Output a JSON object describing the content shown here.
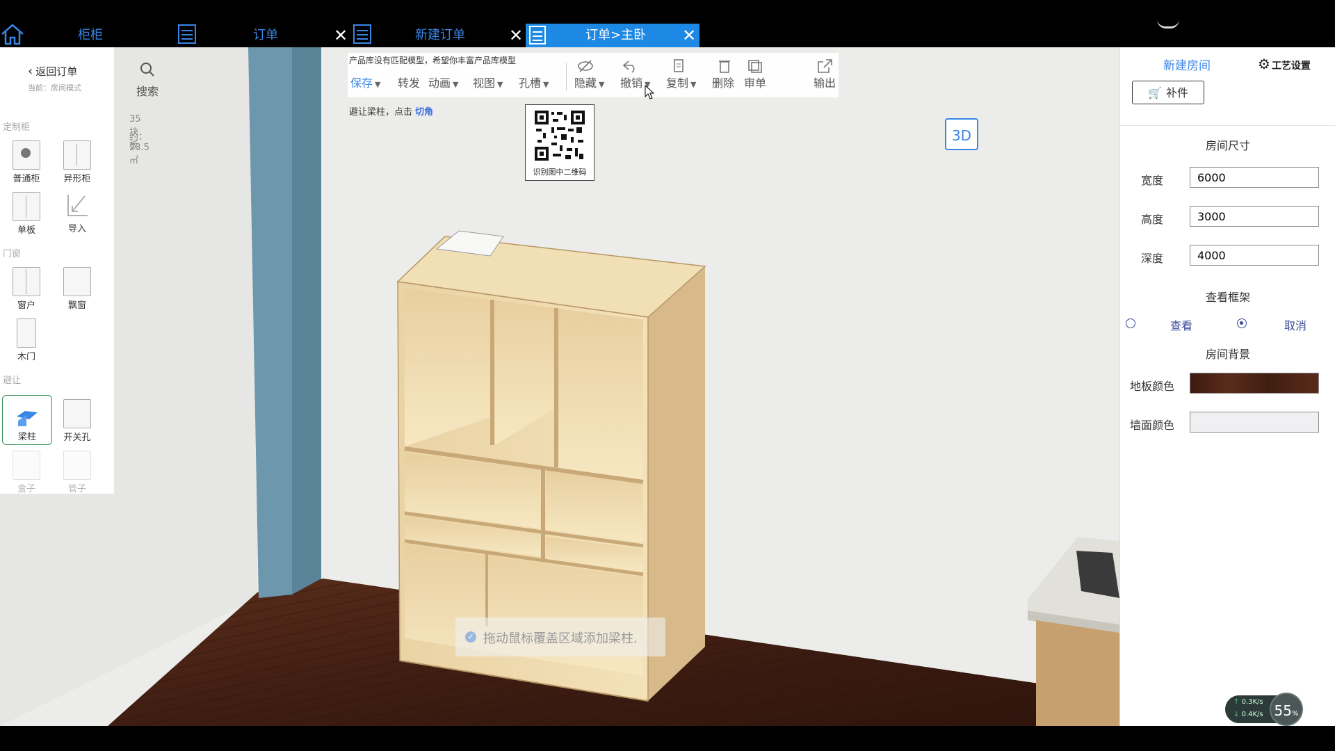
{
  "tabs": {
    "home_icon": "home-icon",
    "items": [
      {
        "label": "柜柜"
      },
      {
        "label": "订单"
      },
      {
        "label": "新建订单"
      },
      {
        "label": "订单>主卧"
      }
    ],
    "close_glyph": "✕"
  },
  "left_panel": {
    "back_label": "返回订单",
    "mode_label": "当前：房间模式",
    "search_label": "搜索",
    "board_count": "35块板",
    "area": "约：23.5㎡",
    "sections": {
      "custom": "定制柜",
      "doors": "门窗",
      "avoid": "避让"
    },
    "tools": {
      "normal_cabinet": "普通柜",
      "shaped_cabinet": "异形柜",
      "single_board": "单板",
      "import": "导入",
      "window": "窗户",
      "bay_window": "飘窗",
      "wood_door": "木门",
      "beam_column": "梁柱",
      "switch_hole": "开关孔",
      "box": "盒子",
      "pipe": "管子"
    }
  },
  "toolbar": {
    "notice": "产品库没有匹配模型，希望你丰富产品库模型",
    "save": "保存",
    "forward": "转发",
    "animation": "动画",
    "view": "视图",
    "hole": "孔槽",
    "hide": "隐藏",
    "undo": "撤销",
    "copy": "复制",
    "delete": "删除",
    "review": "审单",
    "export": "输出"
  },
  "hint": {
    "text": "避让梁柱，点击",
    "link": "切角"
  },
  "qr": {
    "caption": "识别图中二维码"
  },
  "view_mode_button": "3D",
  "toast": "拖动鼠标覆盖区域添加梁柱.",
  "right_panel": {
    "new_room": "新建房间",
    "craft_settings": "工艺设置",
    "parts_button": "补件",
    "room_size_title": "房间尺寸",
    "width_label": "宽度",
    "width_value": "6000",
    "height_label": "高度",
    "height_value": "3000",
    "depth_label": "深度",
    "depth_value": "4000",
    "frame_title": "查看框架",
    "frame_view": "查看",
    "frame_cancel": "取消",
    "frame_selected": "cancel",
    "background_title": "房间背景",
    "floor_color_label": "地板颜色",
    "floor_color": "#4a2416",
    "wall_color_label": "墙面颜色",
    "wall_color": "#f0f0f2"
  },
  "network": {
    "up": "0.3K/s",
    "down": "0.4K/s",
    "percent": "55",
    "percent_unit": "%"
  },
  "colors": {
    "accent": "#1e88e5",
    "link": "#3b6fd8"
  }
}
